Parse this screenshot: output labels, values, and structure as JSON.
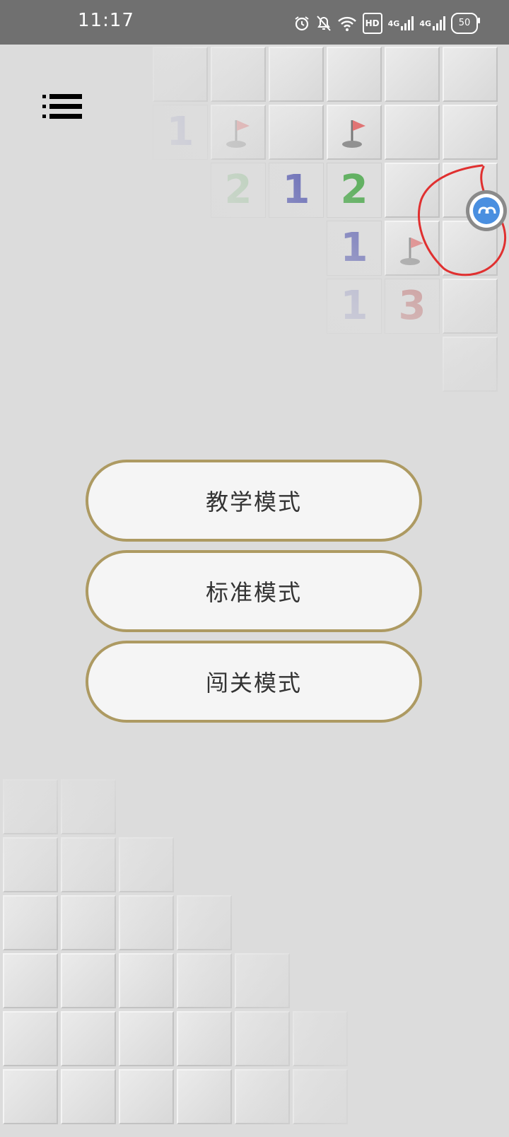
{
  "status_bar": {
    "time": "11:17",
    "icons": [
      "alarm-icon",
      "bell-muted-icon",
      "wifi-icon",
      "hd-icon",
      "signal-4g-icon",
      "signal-4g-icon",
      "battery-icon"
    ],
    "hd_label": "HD",
    "network_1": "4G",
    "network_2": "4G",
    "battery_level": "50"
  },
  "menu": {
    "icon": "menu-list-icon"
  },
  "board_numbers": {
    "n1": "1",
    "n2": "2",
    "n3": "1",
    "n4": "2",
    "n5": "1",
    "n6": "1",
    "n7": "3"
  },
  "colors": {
    "accent_border": "#ad9a62",
    "button_fill": "#f5f5f5",
    "number_blue": "#3a3fa8",
    "number_green": "#3aa23a",
    "number_red": "#b03030",
    "annotation_red": "#e03030"
  },
  "modes": {
    "teaching": "教学模式",
    "standard": "标准模式",
    "challenge": "闯关模式"
  },
  "assistant": {
    "icon": "floating-assistant-icon"
  }
}
